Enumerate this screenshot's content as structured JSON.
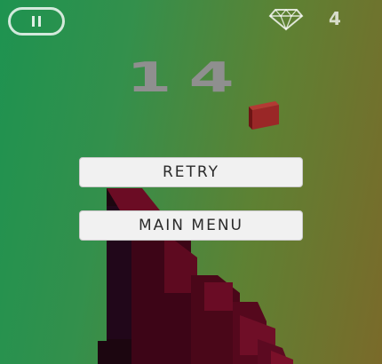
{
  "hud": {
    "pause_icon": "pause-icon",
    "gem_icon": "diamond-icon",
    "gem_count": "4",
    "score": "14"
  },
  "menu": {
    "retry_label": "RETRY",
    "main_menu_label": "MAIN MENU"
  },
  "colors": {
    "background_left": "#1e9350",
    "background_right": "#7a6a2a",
    "tower_dark": "#1c0610",
    "tower_red": "#5a0a1e",
    "falling_block": "#9a2727",
    "score_text": "#8f8f8f",
    "button_bg": "#f1f1f1"
  }
}
